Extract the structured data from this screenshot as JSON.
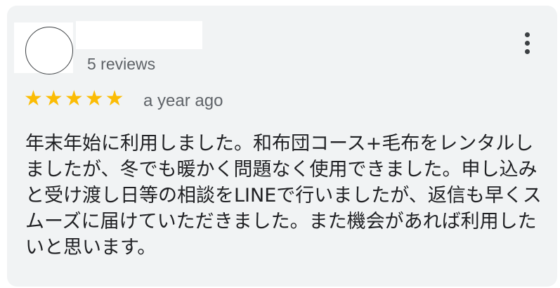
{
  "review": {
    "author_reviews": "5 reviews",
    "rating": 5,
    "stars": [
      "★",
      "★",
      "★",
      "★",
      "★"
    ],
    "date": "a year ago",
    "text": "年末年始に利用しました。和布団コース+毛布をレンタルしましたが、冬でも暖かく問題なく使用できました。申し込みと受け渡し日等の相談をLINEで行いましたが、返信も早くスムーズに届けていただきました。また機会があれば利用したいと思います。",
    "star_color": "#fbbc04",
    "more_icon": "more-vert-icon"
  }
}
